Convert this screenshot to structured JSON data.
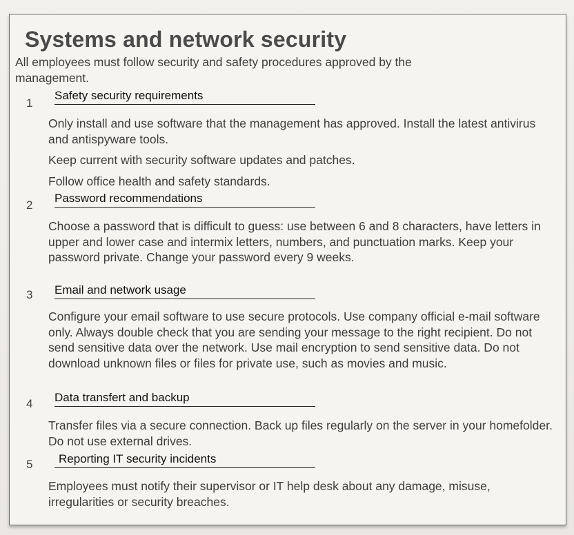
{
  "title": "Systems and network security",
  "intro": "All employees must follow security and safety procedures approved by the management.",
  "sections": [
    {
      "number": "1",
      "heading": "Safety security requirements",
      "paragraphs": [
        "Only install and use software that the management has approved. Install the latest antivirus and antispyware tools.",
        "Keep current with security software updates and patches.",
        "Follow office health and safety standards."
      ]
    },
    {
      "number": "2",
      "heading": "Password recommendations",
      "paragraphs": [
        "Choose a password that is difficult to guess: use between 6 and 8 characters, have letters in upper and lower case and intermix letters, numbers, and punctuation marks. Keep your password private. Change your password every 9 weeks."
      ]
    },
    {
      "number": "3",
      "heading": "Email and network usage",
      "paragraphs": [
        "Configure your email software to use secure protocols. Use company official e-mail software only. Always double check that you are sending your message to the right recipient. Do not send sensitive data over the network. Use mail encryption to send sensitive data. Do not download unknown files or files for private use, such as movies and music."
      ]
    },
    {
      "number": "4",
      "heading": "Data transfert and backup",
      "paragraphs": [
        "Transfer files via a secure connection. Back up files regularly on the server in your homefolder. Do not use external drives."
      ]
    },
    {
      "number": "5",
      "heading": "Reporting IT security incidents",
      "paragraphs": [
        "Employees must notify their supervisor or IT help desk about any damage, misuse, irregularities or security breaches."
      ]
    }
  ]
}
